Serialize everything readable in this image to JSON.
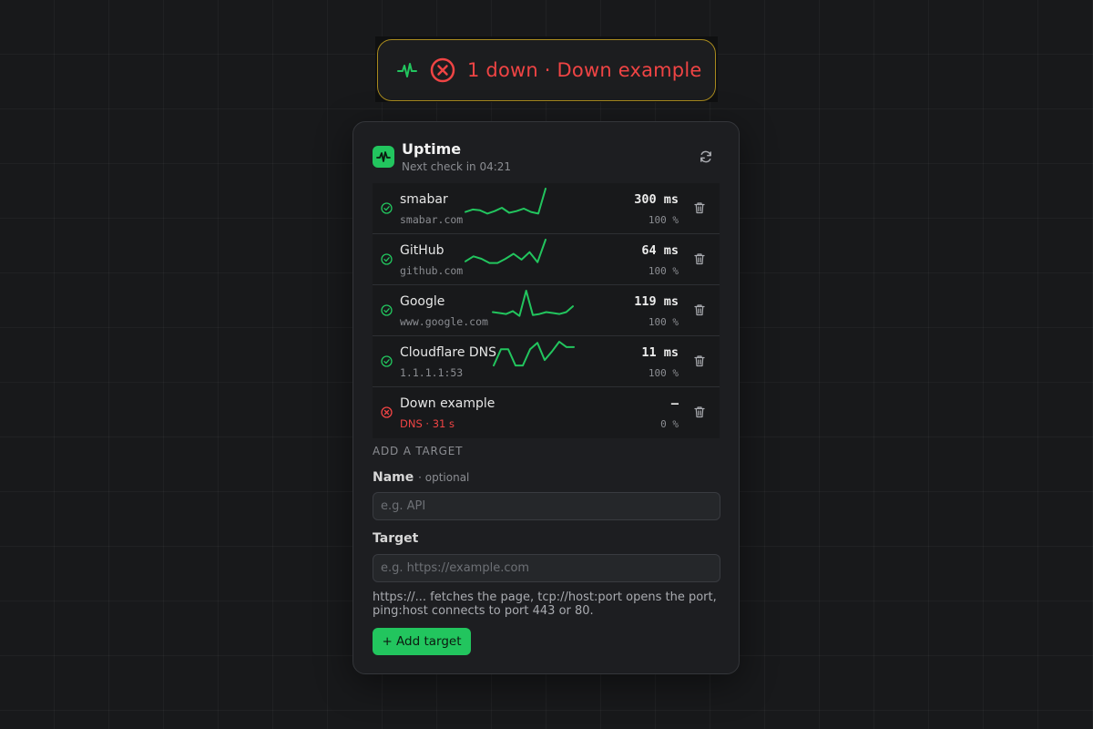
{
  "status_pill": {
    "text": "1 down · Down example",
    "colors": {
      "down": "#ef4444",
      "border": "#a88a1e",
      "pulse": "#22c55e"
    }
  },
  "header": {
    "title": "Uptime",
    "subtitle": "Next check in 04:21"
  },
  "targets": [
    {
      "name": "smabar",
      "host": "smabar.com",
      "latency": "300 ms",
      "uptime": "100 %",
      "status": "up",
      "history": [
        14,
        20,
        18,
        10,
        16,
        24,
        12,
        16,
        22,
        14,
        10,
        70
      ]
    },
    {
      "name": "GitHub",
      "host": "github.com",
      "latency": "64 ms",
      "uptime": "100 %",
      "status": "up",
      "history": [
        18,
        30,
        24,
        14,
        14,
        24,
        36,
        22,
        40,
        16,
        70
      ]
    },
    {
      "name": "Google",
      "host": "www.google.com",
      "latency": "119 ms",
      "uptime": "100 %",
      "status": "up",
      "history": [
        16,
        14,
        12,
        18,
        8,
        60,
        10,
        12,
        16,
        14,
        12,
        16,
        28
      ]
    },
    {
      "name": "Cloudflare DNS",
      "host": "1.1.1.1:53",
      "latency": "11 ms",
      "uptime": "100 %",
      "status": "up",
      "history": [
        10,
        40,
        40,
        10,
        10,
        40,
        52,
        20,
        36,
        54,
        44,
        44
      ]
    },
    {
      "name": "Down example",
      "host": "DNS · 31 s",
      "latency": "–",
      "uptime": "0 %",
      "status": "down",
      "history": []
    }
  ],
  "form": {
    "section_label": "ADD A TARGET",
    "name_label": "Name",
    "name_optional": "· optional",
    "name_placeholder": "e.g. API",
    "target_label": "Target",
    "target_placeholder": "e.g. https://example.com",
    "help": "https://... fetches the page, tcp://host:port opens the port, ping:host connects to port 443 or 80.",
    "add_label": "+ Add target"
  },
  "colors": {
    "up": "#22c55e",
    "down": "#ef4444",
    "accent": "#22c55e"
  }
}
